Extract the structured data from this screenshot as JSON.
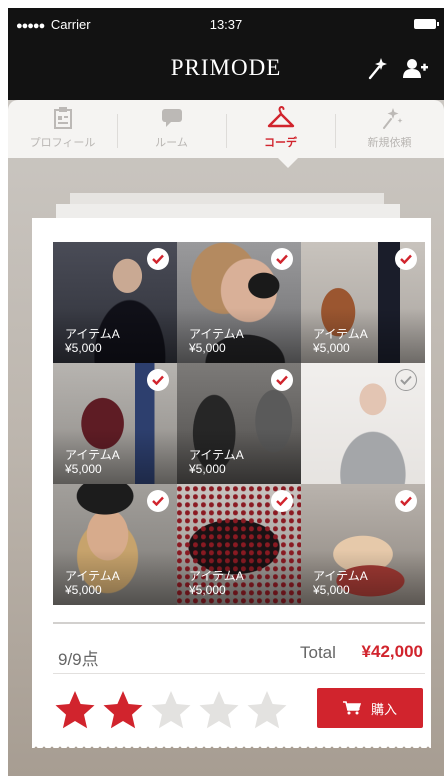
{
  "status_bar": {
    "signal": "●●●●●",
    "carrier": "Carrier",
    "time": "13:37"
  },
  "header": {
    "title": "PRIMODE"
  },
  "tabs": [
    {
      "label": "プロフィール",
      "icon": "profile-board-icon",
      "active": false
    },
    {
      "label": "ルーム",
      "icon": "chat-bubble-icon",
      "active": false
    },
    {
      "label": "コーデ",
      "icon": "hanger-icon",
      "active": true
    },
    {
      "label": "新規依頼",
      "icon": "sparkle-icon",
      "active": false
    }
  ],
  "items": [
    {
      "name": "アイテムA",
      "price": "¥5,000",
      "checked": true
    },
    {
      "name": "アイテムA",
      "price": "¥5,000",
      "checked": true
    },
    {
      "name": "アイテムA",
      "price": "¥5,000",
      "checked": true
    },
    {
      "name": "アイテムA",
      "price": "¥5,000",
      "checked": true
    },
    {
      "name": "アイテムA",
      "price": "¥5,000",
      "checked": true
    },
    {
      "name": "",
      "price": "",
      "checked": false
    },
    {
      "name": "アイテムA",
      "price": "¥5,000",
      "checked": true
    },
    {
      "name": "アイテムA",
      "price": "¥5,000",
      "checked": true
    },
    {
      "name": "アイテムA",
      "price": "¥5,000",
      "checked": true
    }
  ],
  "summary": {
    "count": "9/9点",
    "total_label": "Total",
    "total_value": "¥42,000"
  },
  "rating": {
    "value": 2,
    "max": 5
  },
  "buy_button": {
    "label": "購入"
  },
  "colors": {
    "accent": "#d1242d",
    "topbar": "#121212"
  }
}
